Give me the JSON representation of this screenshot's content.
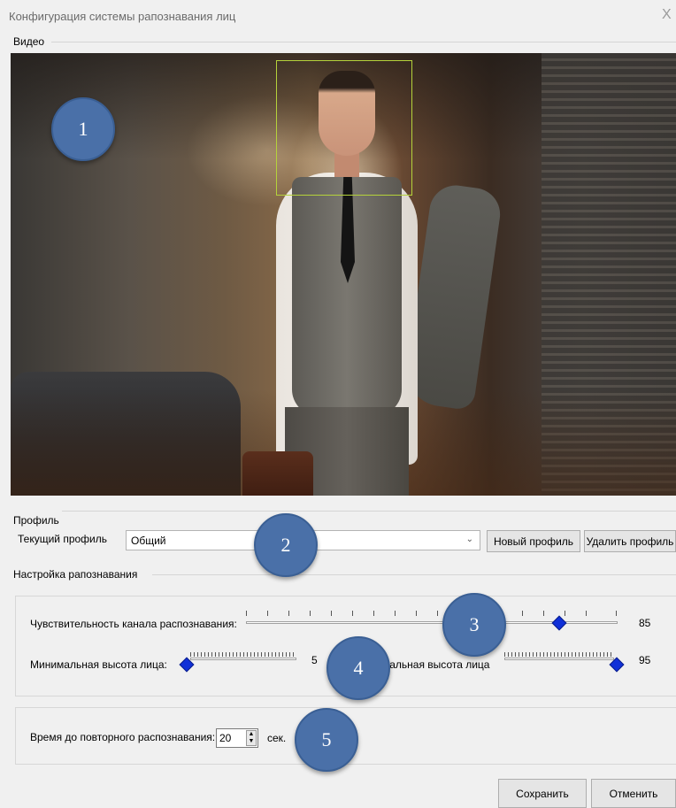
{
  "window": {
    "title": "Конфигурация системы рапознавания лиц",
    "close_glyph": "X"
  },
  "video": {
    "label": "Видео"
  },
  "markers": [
    "1",
    "2",
    "3",
    "4",
    "5"
  ],
  "profile": {
    "group_label": "Профиль",
    "current_label": "Текущий профиль",
    "current_value": "Общий",
    "new_button": "Новый профиль",
    "delete_button": "Удалить профиль"
  },
  "recognition": {
    "group_label": "Настройка рапознавания",
    "sensitivity_label": "Чувствительность канала распознавания:",
    "sensitivity_value": "85",
    "min_height_label": "Минимальная высота лица:",
    "min_height_value": "5",
    "max_height_label": "мальная высота лица",
    "max_height_value": "95"
  },
  "repeat": {
    "label": "Время до повторного распознавания:",
    "value": "20",
    "unit": "сек."
  },
  "footer": {
    "save_button": "Сохранить",
    "cancel_button": "Отменить"
  },
  "colors": {
    "marker": "#4a70a8",
    "slider_thumb": "#1030d8",
    "face_box": "#b5d23b"
  }
}
